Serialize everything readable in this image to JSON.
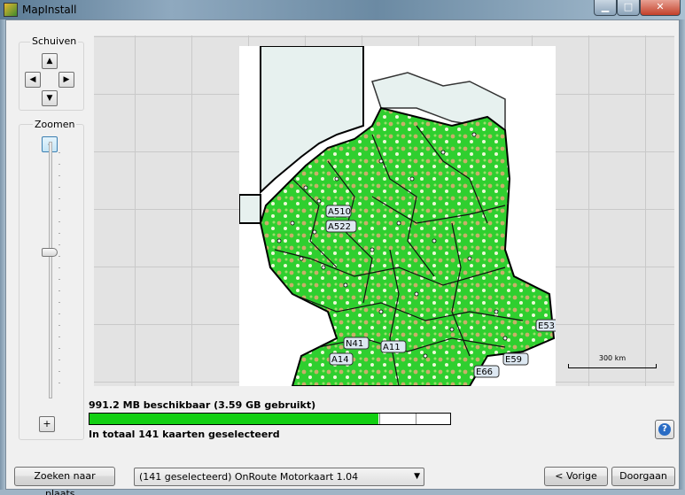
{
  "window": {
    "title": "MapInstall"
  },
  "pan": {
    "label": "Schuiven",
    "up_icon": "▲",
    "left_icon": "◀",
    "right_icon": "▶",
    "down_icon": "▼"
  },
  "zoom": {
    "label": "Zoomen",
    "out_label": "-",
    "in_label": "+",
    "level": 0.59
  },
  "map": {
    "scale_label": "300 km",
    "road_labels": [
      "A510",
      "A522",
      "E53",
      "E59",
      "E66",
      "A11",
      "A14",
      "N41"
    ]
  },
  "storage": {
    "text": "991.2 MB beschikbaar (3.59 GB gebruikt)",
    "used_fraction": 0.8,
    "summary": "In totaal 141 kaarten geselecteerd"
  },
  "footer": {
    "search_label": "Zoeken naar plaats...",
    "map_select_value": "(141 geselecteerd) OnRoute Motorkaart 1.04",
    "back_label": "< Vorige",
    "next_label": "Doorgaan"
  },
  "colors": {
    "progress_fill": "#12cf12",
    "map_green": "#2fcf2f",
    "map_sea": "#e7f1ef"
  }
}
